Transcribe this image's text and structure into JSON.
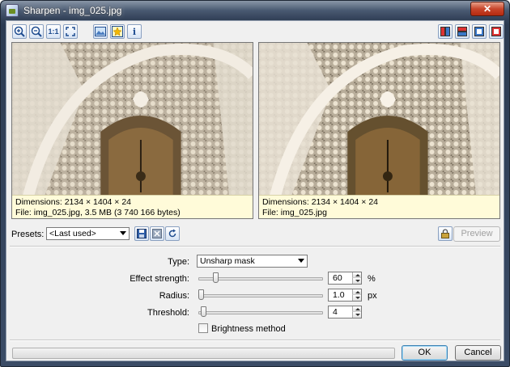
{
  "window": {
    "title": "Sharpen - img_025.jpg"
  },
  "toolbar": {
    "left_icons": [
      "zoom-in-icon",
      "zoom-out-icon",
      "actual-size-icon",
      "fit-to-window-icon",
      "image-levels-icon",
      "highlight-icon",
      "info-icon"
    ],
    "actual_size_label": "1:1",
    "info_label": "i",
    "right_icons": [
      "layout-side-by-side-icon",
      "layout-top-bottom-icon",
      "layout-single-icon",
      "layout-stop-icon"
    ]
  },
  "previews": {
    "left": {
      "dimensions": "Dimensions: 2134 × 1404 × 24",
      "file": "File: img_025.jpg, 3.5 MB (3 740 166 bytes)"
    },
    "right": {
      "dimensions": "Dimensions: 2134 × 1404 × 24",
      "file": "File: img_025.jpg"
    }
  },
  "presets": {
    "label": "Presets:",
    "selected": "<Last used>",
    "icons": [
      "save-preset-icon",
      "delete-preset-icon",
      "reset-preset-icon"
    ]
  },
  "preview_button": {
    "label": "Preview",
    "icon": "lock-icon"
  },
  "params": {
    "type_label": "Type:",
    "type_value": "Unsharp mask",
    "effect_strength": {
      "label": "Effect strength:",
      "value": "60",
      "unit": "%",
      "slider_fraction": 0.12
    },
    "radius": {
      "label": "Radius:",
      "value": "1.0",
      "unit": "px",
      "slider_fraction": 0.0
    },
    "threshold": {
      "label": "Threshold:",
      "value": "4",
      "unit": "",
      "slider_fraction": 0.02
    },
    "brightness_label": "Brightness method",
    "brightness_checked": false
  },
  "footer": {
    "progress_fraction": 0.0,
    "ok_label": "OK",
    "cancel_label": "Cancel"
  }
}
